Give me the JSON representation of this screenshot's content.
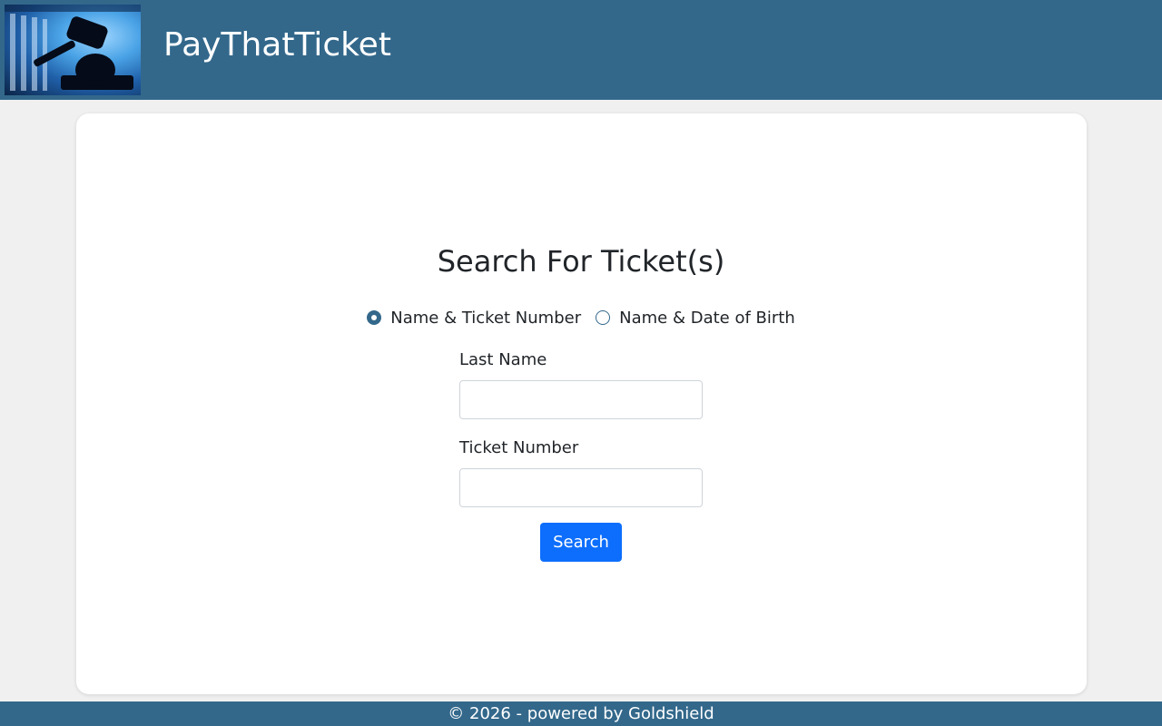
{
  "header": {
    "title": "PayThatTicket",
    "logo_icon": "gavel-courthouse-logo"
  },
  "main": {
    "title": "Search For Ticket(s)",
    "search_type": {
      "options": [
        {
          "label": "Name & Ticket Number",
          "checked": true
        },
        {
          "label": "Name & Date of Birth",
          "checked": false
        }
      ]
    },
    "fields": {
      "last_name": {
        "label": "Last Name",
        "value": "",
        "placeholder": ""
      },
      "ticket_number": {
        "label": "Ticket Number",
        "value": "",
        "placeholder": ""
      }
    },
    "search_button": "Search"
  },
  "footer": {
    "text": "© 2026 - powered by Goldshield"
  },
  "colors": {
    "header_bg": "#33688b",
    "button_bg": "#0d6efd",
    "page_bg": "#f0f0f0"
  }
}
